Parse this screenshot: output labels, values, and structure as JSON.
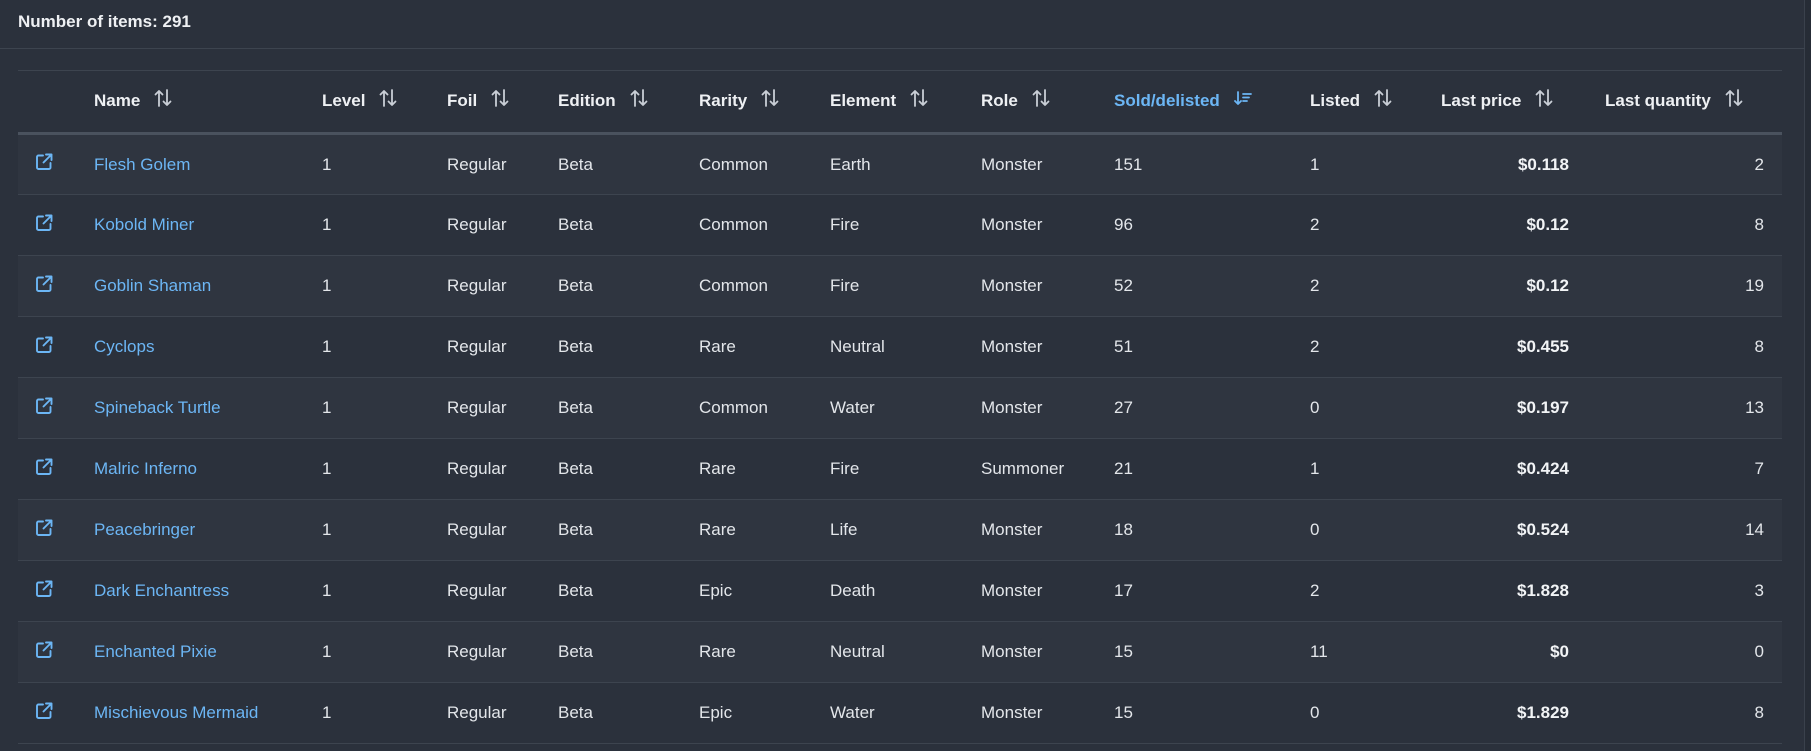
{
  "summary": {
    "items_label": "Number of items: 291"
  },
  "colors": {
    "background": "#2b313c",
    "row_alt": "#2f3540",
    "accent": "#6cb6f5",
    "text": "#e3e6ea"
  },
  "table": {
    "columns": [
      {
        "key": "link",
        "label": ""
      },
      {
        "key": "name",
        "label": "Name",
        "sort_icon": "sort-both-icon"
      },
      {
        "key": "level",
        "label": "Level",
        "sort_icon": "sort-both-icon"
      },
      {
        "key": "foil",
        "label": "Foil",
        "sort_icon": "sort-both-icon"
      },
      {
        "key": "edition",
        "label": "Edition",
        "sort_icon": "sort-both-icon"
      },
      {
        "key": "rarity",
        "label": "Rarity",
        "sort_icon": "sort-both-icon"
      },
      {
        "key": "element",
        "label": "Element",
        "sort_icon": "sort-both-icon"
      },
      {
        "key": "role",
        "label": "Role",
        "sort_icon": "sort-both-icon"
      },
      {
        "key": "sold",
        "label": "Sold/delisted",
        "sort_icon": "sort-descending-icon",
        "active": true
      },
      {
        "key": "listed",
        "label": "Listed",
        "sort_icon": "sort-both-icon"
      },
      {
        "key": "last_price",
        "label": "Last price",
        "sort_icon": "sort-both-icon"
      },
      {
        "key": "last_quantity",
        "label": "Last quantity",
        "sort_icon": "sort-both-icon"
      }
    ],
    "rows": [
      {
        "name": "Flesh Golem",
        "level": "1",
        "foil": "Regular",
        "edition": "Beta",
        "rarity": "Common",
        "element": "Earth",
        "role": "Monster",
        "sold": "151",
        "listed": "1",
        "last_price": "$0.118",
        "last_quantity": "2"
      },
      {
        "name": "Kobold Miner",
        "level": "1",
        "foil": "Regular",
        "edition": "Beta",
        "rarity": "Common",
        "element": "Fire",
        "role": "Monster",
        "sold": "96",
        "listed": "2",
        "last_price": "$0.12",
        "last_quantity": "8"
      },
      {
        "name": "Goblin Shaman",
        "level": "1",
        "foil": "Regular",
        "edition": "Beta",
        "rarity": "Common",
        "element": "Fire",
        "role": "Monster",
        "sold": "52",
        "listed": "2",
        "last_price": "$0.12",
        "last_quantity": "19"
      },
      {
        "name": "Cyclops",
        "level": "1",
        "foil": "Regular",
        "edition": "Beta",
        "rarity": "Rare",
        "element": "Neutral",
        "role": "Monster",
        "sold": "51",
        "listed": "2",
        "last_price": "$0.455",
        "last_quantity": "8"
      },
      {
        "name": "Spineback Turtle",
        "level": "1",
        "foil": "Regular",
        "edition": "Beta",
        "rarity": "Common",
        "element": "Water",
        "role": "Monster",
        "sold": "27",
        "listed": "0",
        "last_price": "$0.197",
        "last_quantity": "13"
      },
      {
        "name": "Malric Inferno",
        "level": "1",
        "foil": "Regular",
        "edition": "Beta",
        "rarity": "Rare",
        "element": "Fire",
        "role": "Summoner",
        "sold": "21",
        "listed": "1",
        "last_price": "$0.424",
        "last_quantity": "7"
      },
      {
        "name": "Peacebringer",
        "level": "1",
        "foil": "Regular",
        "edition": "Beta",
        "rarity": "Rare",
        "element": "Life",
        "role": "Monster",
        "sold": "18",
        "listed": "0",
        "last_price": "$0.524",
        "last_quantity": "14"
      },
      {
        "name": "Dark Enchantress",
        "level": "1",
        "foil": "Regular",
        "edition": "Beta",
        "rarity": "Epic",
        "element": "Death",
        "role": "Monster",
        "sold": "17",
        "listed": "2",
        "last_price": "$1.828",
        "last_quantity": "3"
      },
      {
        "name": "Enchanted Pixie",
        "level": "1",
        "foil": "Regular",
        "edition": "Beta",
        "rarity": "Rare",
        "element": "Neutral",
        "role": "Monster",
        "sold": "15",
        "listed": "11",
        "last_price": "$0",
        "last_quantity": "0"
      },
      {
        "name": "Mischievous Mermaid",
        "level": "1",
        "foil": "Regular",
        "edition": "Beta",
        "rarity": "Epic",
        "element": "Water",
        "role": "Monster",
        "sold": "15",
        "listed": "0",
        "last_price": "$1.829",
        "last_quantity": "8"
      }
    ]
  }
}
